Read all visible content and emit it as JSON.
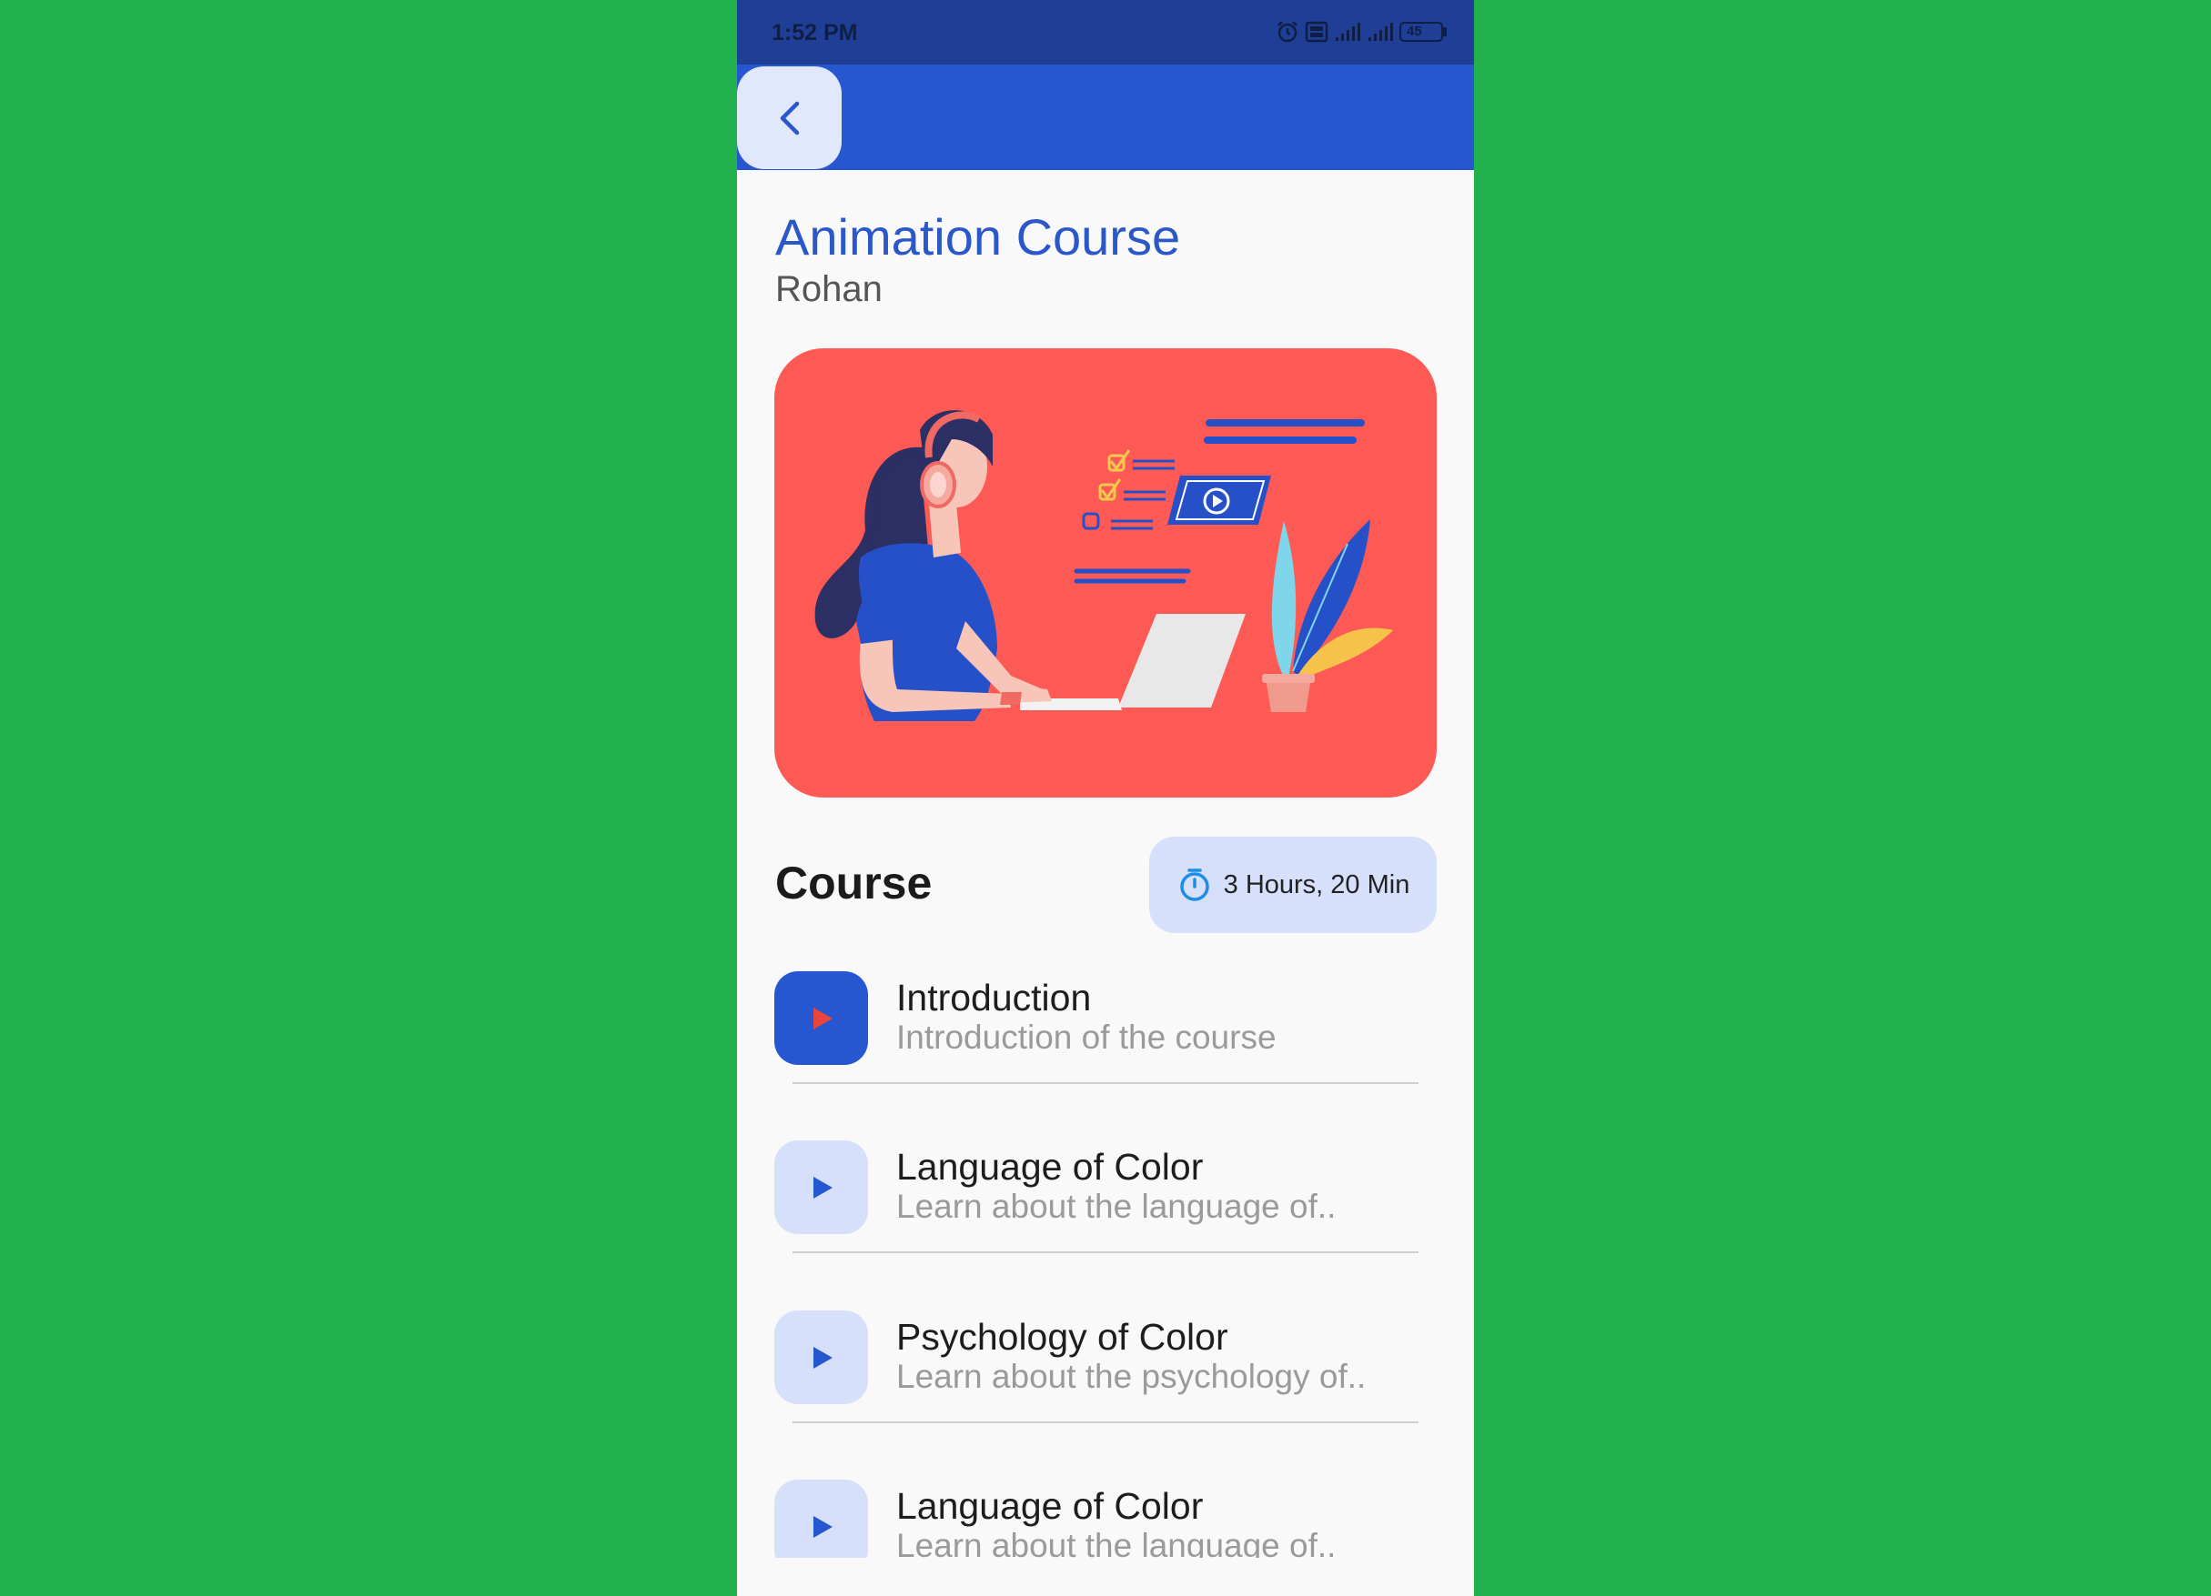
{
  "status_bar": {
    "time": "1:52 PM",
    "battery": "45"
  },
  "header": {
    "back_icon": "chevron-left-icon"
  },
  "course": {
    "title": "Animation Course",
    "author": "Rohan"
  },
  "section": {
    "label": "Course",
    "duration": "3 Hours, 20 Min",
    "duration_icon": "stopwatch-icon"
  },
  "lessons": [
    {
      "title": "Introduction",
      "subtitle": "Introduction of the course",
      "active": true
    },
    {
      "title": "Language of Color",
      "subtitle": "Learn about the language of..",
      "active": false
    },
    {
      "title": "Psychology of Color",
      "subtitle": "Learn about the psychology of..",
      "active": false
    },
    {
      "title": "Language of Color",
      "subtitle": "Learn about the language of..",
      "active": false
    }
  ],
  "colors": {
    "background": "#23b14d",
    "status_bar": "#1e3f95",
    "app_bar": "#2757d0",
    "accent": "#2b58c9",
    "hero": "#fe5a55",
    "chip": "#d6e0fb",
    "play_active_icon": "#e8453c"
  }
}
